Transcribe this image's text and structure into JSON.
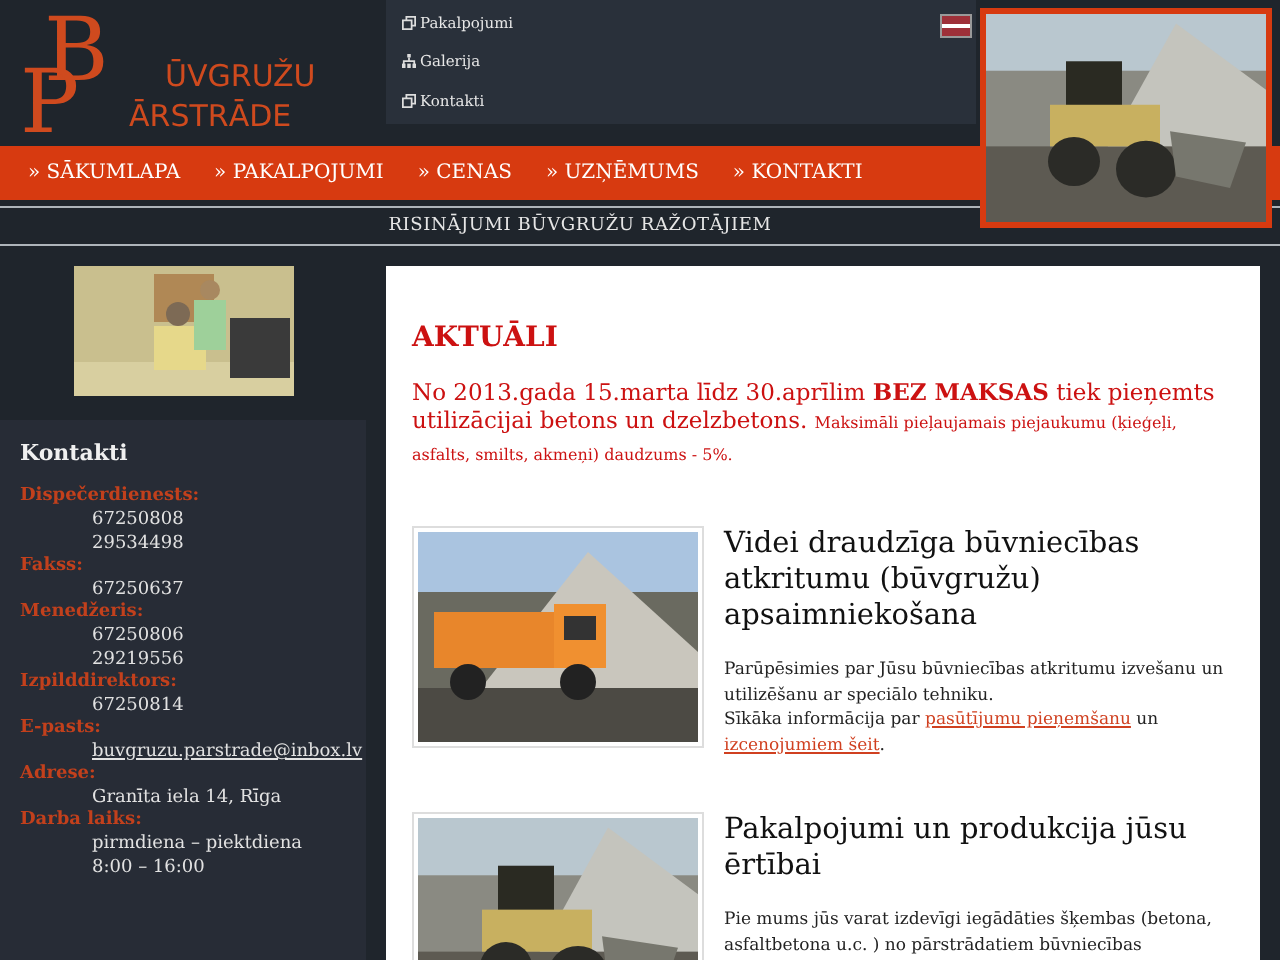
{
  "logo": {
    "letter_1": "B",
    "word_1": "ŪVGRUŽU",
    "letter_2": "P",
    "word_2": "ĀRSTRĀDE"
  },
  "top_menu": [
    {
      "label": "Pakalpojumi",
      "kind": "page"
    },
    {
      "label": "Galerija",
      "kind": "sitemap"
    },
    {
      "label": "Kontakti",
      "kind": "page"
    }
  ],
  "main_nav": [
    {
      "label": "» SĀKUMLAPA"
    },
    {
      "label": "» PAKALPOJUMI"
    },
    {
      "label": "» CENAS"
    },
    {
      "label": "» UZŅĒMUMS"
    },
    {
      "label": "» KONTAKTI"
    }
  ],
  "tagline": "RISINĀJUMI BŪVGRUŽU RAŽOTĀJIEM",
  "contacts": {
    "title": "Kontakti",
    "groups": [
      {
        "label": "Dispečerdienests:",
        "kind": "text",
        "values": [
          "67250808",
          "29534498"
        ]
      },
      {
        "label": "Fakss:",
        "kind": "text",
        "values": [
          "67250637"
        ]
      },
      {
        "label": "Menedžeris:",
        "kind": "text",
        "values": [
          "67250806",
          "29219556"
        ]
      },
      {
        "label": "Izpilddirektors:",
        "kind": "text",
        "values": [
          "67250814"
        ]
      },
      {
        "label": "E-pasts:",
        "kind": "email",
        "values": [
          "buvgruzu.parstrade@inbox.lv"
        ]
      },
      {
        "label": "Adrese:",
        "kind": "text",
        "values": [
          "Granīta iela 14, Rīga"
        ]
      },
      {
        "label": "Darba laiks:",
        "kind": "text",
        "values": [
          "pirmdiena – piektdiena",
          "8:00 – 16:00"
        ]
      }
    ]
  },
  "news": {
    "title": "AKTUĀLI",
    "text": "No 2013.gada 15.marta līdz 30.aprīlim **BEZ MAKSAS** tiek pieņemts utilizācijai betons un dzelzbetons.",
    "note": "Maksimāli pieļaujamais piejaukumu (ķieģeļi, asfalts, smilts, akmeņi) daudzums - 5%."
  },
  "articles": [
    {
      "title": "Videi draudzīga būvniecības atkritumu (būvgružu) apsaimniekošana",
      "paragraphs": [
        [
          {
            "kind": "text",
            "text": "Parūpēsimies par Jūsu būvniecības atkritumu izvešanu un utilizēšanu ar speciālo tehniku."
          }
        ],
        [
          {
            "kind": "text",
            "text": "Sīkāka informācija par "
          },
          {
            "kind": "link",
            "text": "pasūtījumu pieņemšanu"
          },
          {
            "kind": "text",
            "text": " un "
          },
          {
            "kind": "link",
            "text": "izcenojumiem šeit"
          },
          {
            "kind": "text",
            "text": "."
          }
        ]
      ]
    },
    {
      "title": "Pakalpojumi un produkcija jūsu ērtībai",
      "paragraphs": [
        [
          {
            "kind": "text",
            "text": "Pie mums jūs varat izdevīgi iegādāties šķembas (betona, asfaltbetona u.c. ) no pārstrādatiem būvniecības"
          }
        ]
      ]
    }
  ]
}
